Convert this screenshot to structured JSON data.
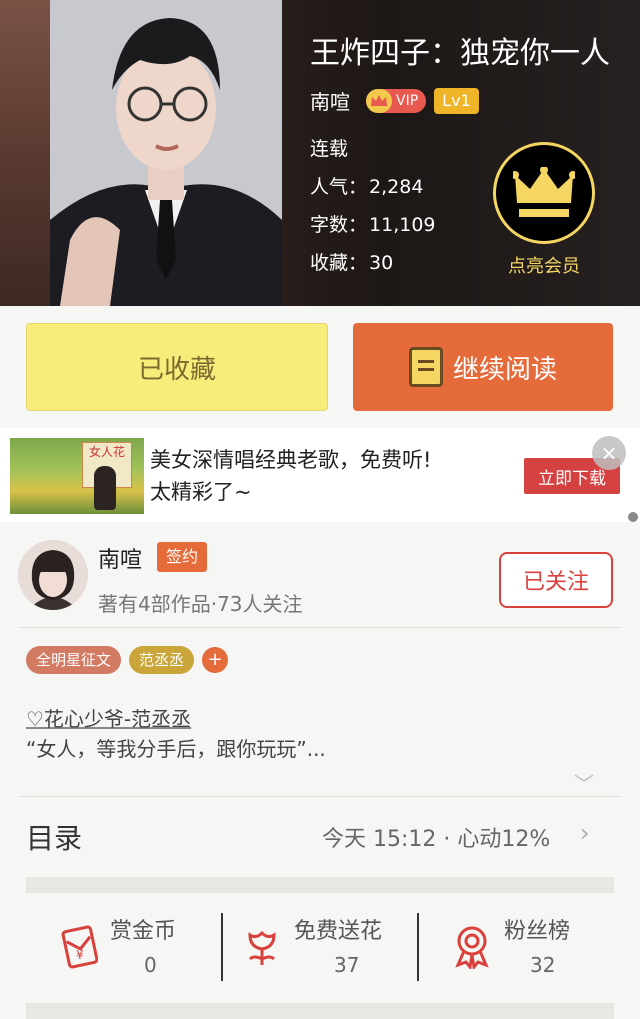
{
  "book": {
    "title": "王炸四子：独宠你一人",
    "author": "南喧",
    "vip_label": "VIP",
    "level": "Lv1",
    "status": "连载",
    "popularity_label": "人气：",
    "popularity_value": "2,284",
    "words_label": "字数：",
    "words_value": "11,109",
    "favorites_label": "收藏：",
    "favorites_value": "30"
  },
  "member": {
    "label": "点亮会员"
  },
  "actions": {
    "collected": "已收藏",
    "continue_reading": "继续阅读"
  },
  "ad": {
    "image_sign": "女人花",
    "line1": "美女深情唱经典老歌，免费听!",
    "line2": "太精彩了~",
    "button": "立即下载",
    "close": "×"
  },
  "author": {
    "name": "南喧",
    "sign_tag": "签约",
    "meta": "著有4部作品·73人关注",
    "follow_button": "已关注"
  },
  "tags": [
    {
      "label": "全明星征文",
      "color": "#d37a63"
    },
    {
      "label": "范丞丞",
      "color": "#c9a53a"
    }
  ],
  "tag_add": "+",
  "blurb": {
    "line1": "♡花心少爷-范丞丞",
    "line2": "“女人，等我分手后，跟你玩玩”..."
  },
  "catalog": {
    "label": "目录",
    "info": "今天 15:12 · 心动12%",
    "chevron": "›"
  },
  "stats": [
    {
      "label": "赏金币",
      "value": "0",
      "icon": "red-envelope-icon"
    },
    {
      "label": "免费送花",
      "value": "37",
      "icon": "flower-icon"
    },
    {
      "label": "粉丝榜",
      "value": "32",
      "icon": "medal-icon"
    }
  ],
  "colors": {
    "accent": "#e56b3a",
    "follow": "#d9413c",
    "gold": "#f5d663"
  }
}
